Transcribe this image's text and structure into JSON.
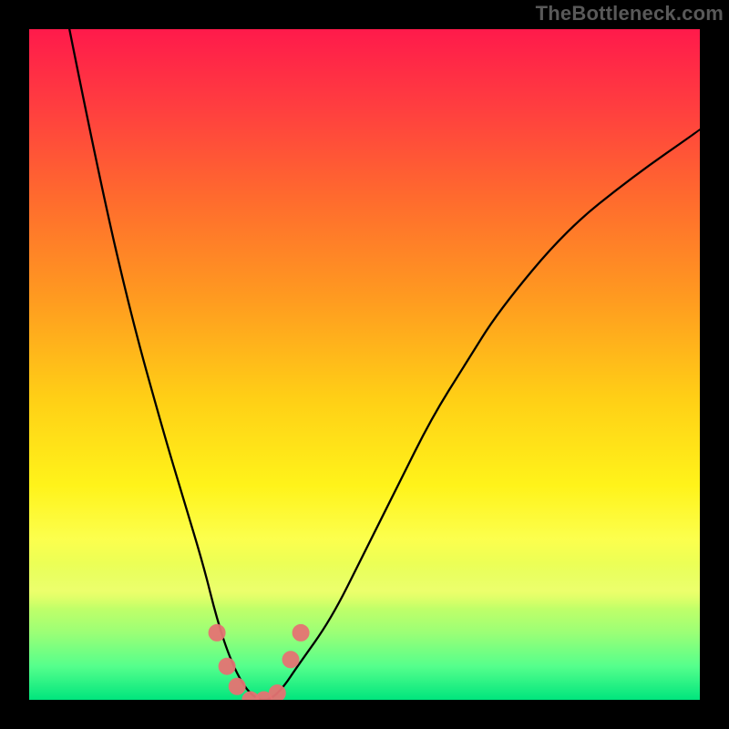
{
  "domain": "Chart",
  "site_label": "TheBottleneck.com",
  "chart_data": {
    "type": "line",
    "title": "",
    "xlabel": "",
    "ylabel": "",
    "xlim": [
      0,
      100
    ],
    "ylim": [
      0,
      100
    ],
    "grid": false,
    "gradient_background": {
      "top_color": "#ff1a4b",
      "bottom_color": "#00e57d",
      "description": "vertical red-to-green gradient indicating bottleneck severity"
    },
    "series": [
      {
        "name": "bottleneck-curve",
        "description": "V-shaped bottleneck curve; y ≈ percentage bottleneck, lower is better",
        "x": [
          6,
          10,
          15,
          20,
          23,
          26,
          28,
          30,
          32,
          34,
          36,
          38,
          40,
          45,
          50,
          55,
          60,
          65,
          70,
          80,
          90,
          100
        ],
        "values": [
          100,
          80,
          58,
          40,
          30,
          20,
          12,
          6,
          2,
          0,
          0,
          2,
          5,
          12,
          22,
          32,
          42,
          50,
          58,
          70,
          78,
          85
        ]
      }
    ],
    "markers": {
      "name": "data-points",
      "description": "salmon circular markers along the curve near the minimum",
      "x": [
        28,
        29.5,
        31,
        33,
        35,
        37,
        39,
        40.5
      ],
      "values": [
        10,
        5,
        2,
        0,
        0,
        1,
        6,
        10
      ]
    }
  }
}
